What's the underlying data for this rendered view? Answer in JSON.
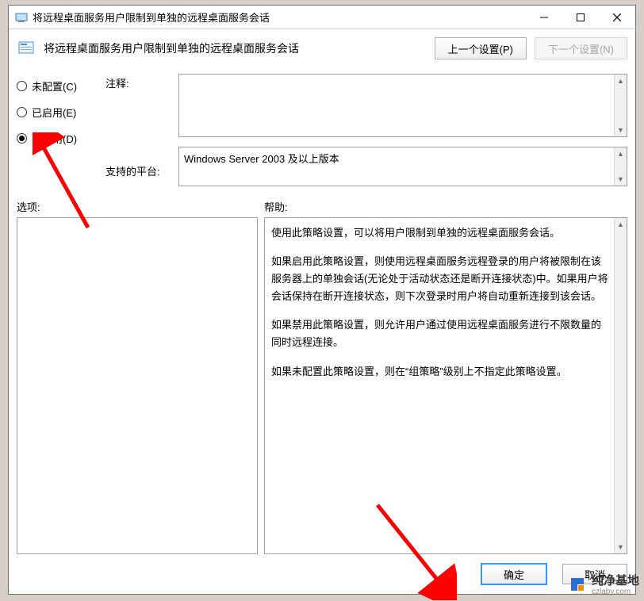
{
  "window": {
    "title": "将远程桌面服务用户限制到单独的远程桌面服务会话"
  },
  "header": {
    "title": "将远程桌面服务用户限制到单独的远程桌面服务会话",
    "prev_label": "上一个设置(P)",
    "next_label": "下一个设置(N)"
  },
  "radios": {
    "not_configured": "未配置(C)",
    "enabled": "已启用(E)",
    "disabled": "已禁用(D)"
  },
  "labels": {
    "comment": "注释:",
    "supported": "支持的平台:",
    "options": "选项:",
    "help": "帮助:"
  },
  "platform_text": "Windows Server 2003 及以上版本",
  "help": {
    "p1": "使用此策略设置，可以将用户限制到单独的远程桌面服务会话。",
    "p2": "如果启用此策略设置，则使用远程桌面服务远程登录的用户将被限制在该服务器上的单独会话(无论处于活动状态还是断开连接状态)中。如果用户将会话保持在断开连接状态，则下次登录时用户将自动重新连接到该会话。",
    "p3": "如果禁用此策略设置，则允许用户通过使用远程桌面服务进行不限数量的同时远程连接。",
    "p4": "如果未配置此策略设置，则在“组策略”级别上不指定此策略设置。"
  },
  "footer": {
    "ok": "确定",
    "cancel": "取消"
  },
  "watermark": {
    "text": "纯净基地",
    "url": "czlaby.com"
  }
}
